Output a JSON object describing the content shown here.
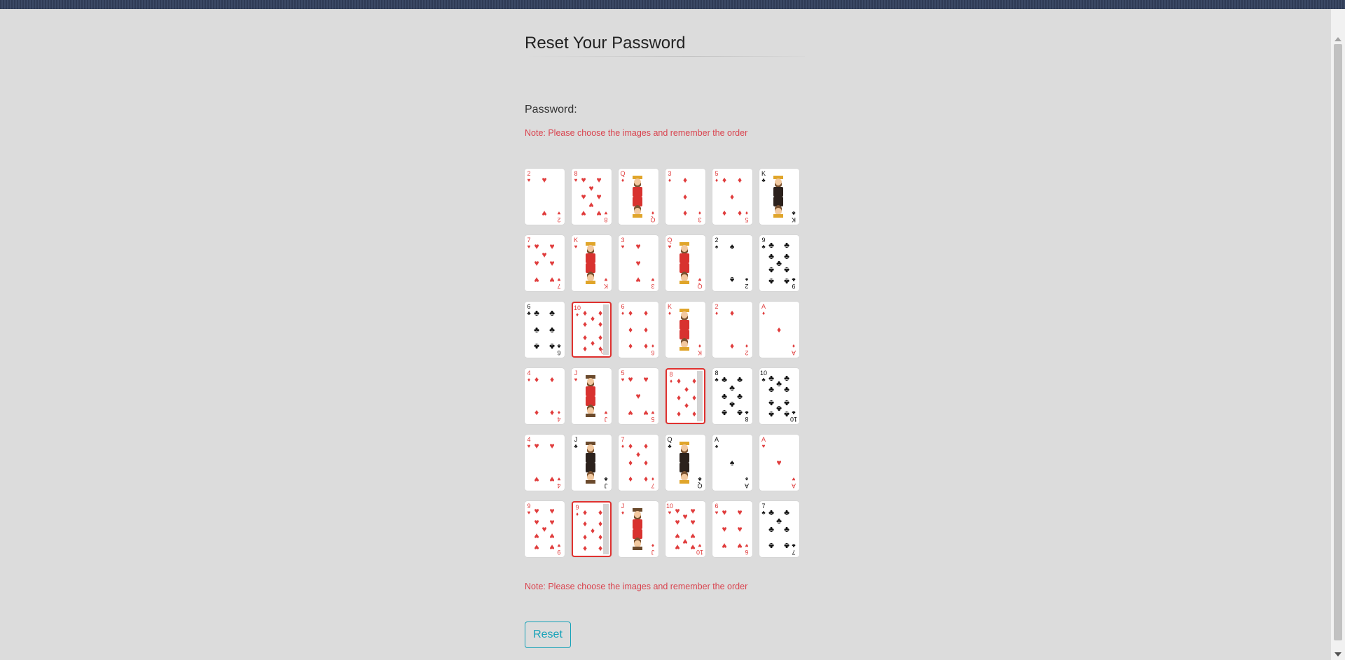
{
  "page": {
    "title": "Reset Your Password"
  },
  "form": {
    "password_label": "Password:",
    "note_top": "Note: Please choose the images and remember the order",
    "note_bottom": "Note: Please choose the images and remember the order",
    "reset_label": "Reset"
  },
  "colors": {
    "red_suit": "#e03c3c",
    "black_suit": "#111111",
    "selected_border": "#e0312f",
    "button_accent": "#17a2b8",
    "note": "#d9434e"
  },
  "cards": [
    {
      "rank": "2",
      "suit": "hearts",
      "selected": false
    },
    {
      "rank": "8",
      "suit": "hearts",
      "selected": false
    },
    {
      "rank": "Q",
      "suit": "diamonds",
      "selected": false
    },
    {
      "rank": "3",
      "suit": "diamonds",
      "selected": false
    },
    {
      "rank": "5",
      "suit": "diamonds",
      "selected": false
    },
    {
      "rank": "K",
      "suit": "clubs",
      "selected": false
    },
    {
      "rank": "7",
      "suit": "hearts",
      "selected": false
    },
    {
      "rank": "K",
      "suit": "hearts",
      "selected": false
    },
    {
      "rank": "3",
      "suit": "hearts",
      "selected": false
    },
    {
      "rank": "Q",
      "suit": "hearts",
      "selected": false
    },
    {
      "rank": "2",
      "suit": "spades",
      "selected": false
    },
    {
      "rank": "9",
      "suit": "clubs",
      "selected": false
    },
    {
      "rank": "6",
      "suit": "clubs",
      "selected": false
    },
    {
      "rank": "10",
      "suit": "diamonds",
      "selected": true
    },
    {
      "rank": "6",
      "suit": "diamonds",
      "selected": false
    },
    {
      "rank": "K",
      "suit": "diamonds",
      "selected": false
    },
    {
      "rank": "2",
      "suit": "diamonds",
      "selected": false
    },
    {
      "rank": "A",
      "suit": "diamonds",
      "selected": false
    },
    {
      "rank": "4",
      "suit": "diamonds",
      "selected": false
    },
    {
      "rank": "J",
      "suit": "hearts",
      "selected": false
    },
    {
      "rank": "5",
      "suit": "hearts",
      "selected": false
    },
    {
      "rank": "8",
      "suit": "diamonds",
      "selected": true
    },
    {
      "rank": "8",
      "suit": "clubs",
      "selected": false
    },
    {
      "rank": "10",
      "suit": "clubs",
      "selected": false
    },
    {
      "rank": "4",
      "suit": "hearts",
      "selected": false
    },
    {
      "rank": "J",
      "suit": "clubs",
      "selected": false
    },
    {
      "rank": "7",
      "suit": "diamonds",
      "selected": false
    },
    {
      "rank": "Q",
      "suit": "clubs",
      "selected": false
    },
    {
      "rank": "A",
      "suit": "spades",
      "selected": false
    },
    {
      "rank": "A",
      "suit": "hearts",
      "selected": false
    },
    {
      "rank": "9",
      "suit": "hearts",
      "selected": false
    },
    {
      "rank": "9",
      "suit": "diamonds",
      "selected": true
    },
    {
      "rank": "J",
      "suit": "diamonds",
      "selected": false
    },
    {
      "rank": "10",
      "suit": "hearts",
      "selected": false
    },
    {
      "rank": "6",
      "suit": "hearts",
      "selected": false
    },
    {
      "rank": "7",
      "suit": "clubs",
      "selected": false
    }
  ]
}
